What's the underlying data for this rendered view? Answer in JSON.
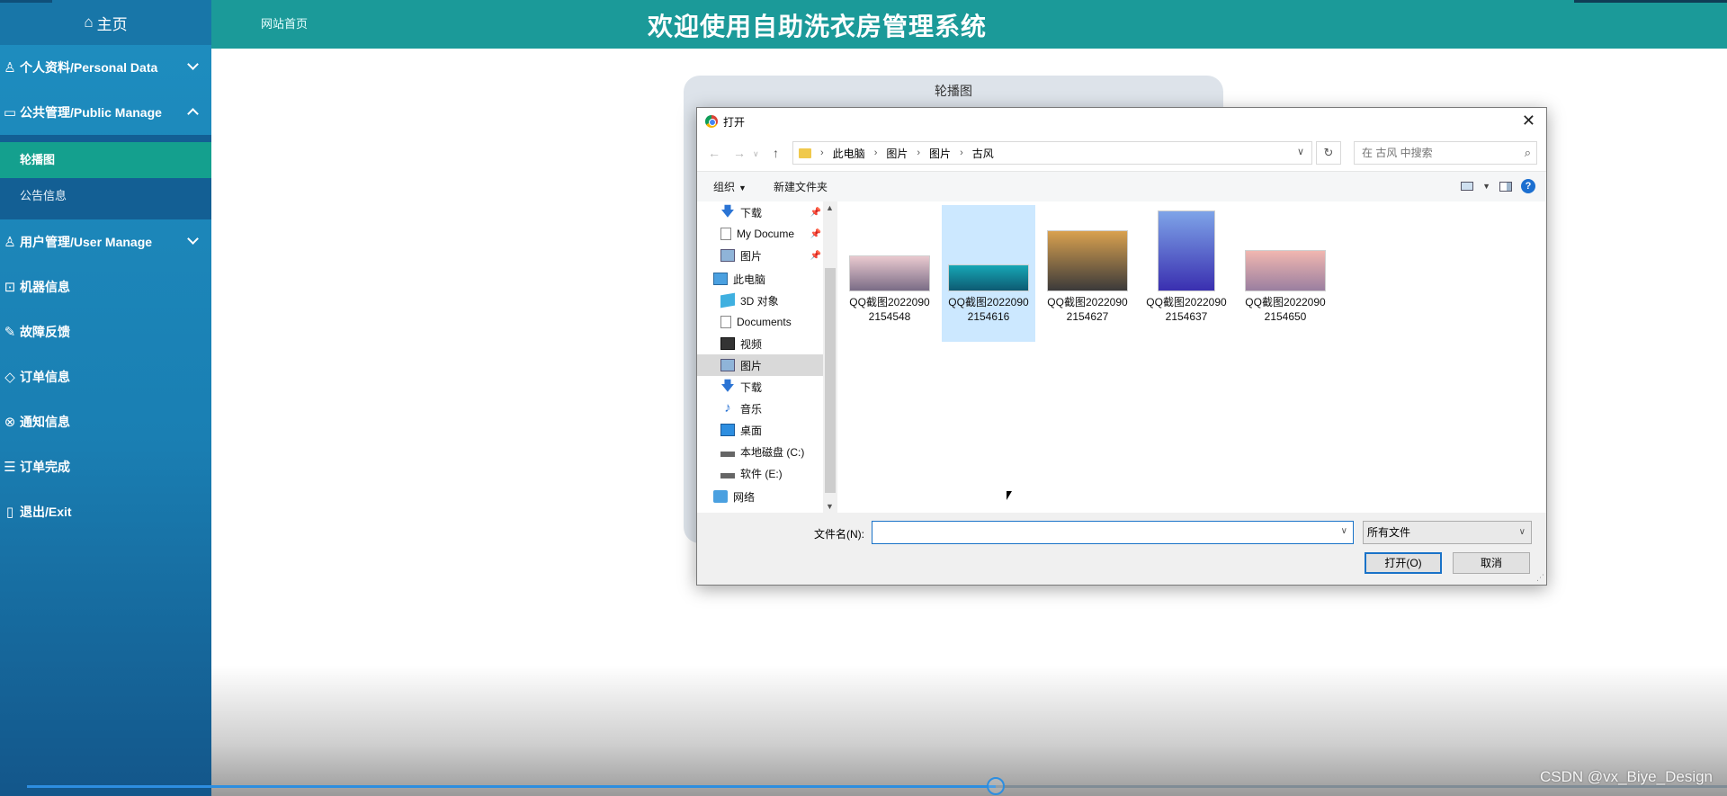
{
  "sidebar": {
    "home_label": "主页",
    "items": [
      {
        "label": "个人资料/Personal Data",
        "icon": "user-card-icon"
      },
      {
        "label": "公共管理/Public Manage",
        "icon": "monitor-icon"
      },
      {
        "label": "用户管理/User Manage",
        "icon": "user-icon"
      },
      {
        "label": "机器信息",
        "icon": "machine-icon"
      },
      {
        "label": "故障反馈",
        "icon": "wrench-icon"
      },
      {
        "label": "订单信息",
        "icon": "tag-icon"
      },
      {
        "label": "通知信息",
        "icon": "bell-icon"
      },
      {
        "label": "订单完成",
        "icon": "clipboard-icon"
      },
      {
        "label": "退出/Exit",
        "icon": "phone-icon"
      }
    ],
    "submenu": [
      {
        "label": "轮播图"
      },
      {
        "label": "公告信息"
      }
    ]
  },
  "topbar": {
    "nav_link": "网站首页",
    "title": "欢迎使用自助洗衣房管理系统"
  },
  "card": {
    "title": "轮播图"
  },
  "dialog": {
    "title": "打开",
    "breadcrumbs": [
      "此电脑",
      "图片",
      "图片",
      "古风"
    ],
    "search_placeholder": "在 古风 中搜索",
    "toolbar": {
      "organize": "组织",
      "new_folder": "新建文件夹"
    },
    "tree": [
      {
        "label": "下载",
        "icon": "down-arrow",
        "pinned": true,
        "indent": 1
      },
      {
        "label": "My Docume",
        "icon": "doc",
        "pinned": true,
        "indent": 1
      },
      {
        "label": "图片",
        "icon": "pic",
        "pinned": true,
        "indent": 1
      },
      {
        "label": "此电脑",
        "icon": "pc",
        "pinned": false,
        "indent": 0
      },
      {
        "label": "3D 对象",
        "icon": "3d",
        "pinned": false,
        "indent": 1
      },
      {
        "label": "Documents",
        "icon": "doc",
        "pinned": false,
        "indent": 1
      },
      {
        "label": "视频",
        "icon": "vid",
        "pinned": false,
        "indent": 1
      },
      {
        "label": "图片",
        "icon": "pic",
        "pinned": false,
        "indent": 1,
        "selected": true
      },
      {
        "label": "下载",
        "icon": "down-arrow",
        "pinned": false,
        "indent": 1
      },
      {
        "label": "音乐",
        "icon": "music",
        "pinned": false,
        "indent": 1
      },
      {
        "label": "桌面",
        "icon": "desk",
        "pinned": false,
        "indent": 1
      },
      {
        "label": "本地磁盘 (C:)",
        "icon": "disk",
        "pinned": false,
        "indent": 1
      },
      {
        "label": "软件 (E:)",
        "icon": "disk",
        "pinned": false,
        "indent": 1
      },
      {
        "label": "网络",
        "icon": "net",
        "pinned": false,
        "indent": 0
      }
    ],
    "files": [
      {
        "name": "QQ截图20220902154548",
        "selected": false,
        "colors": [
          "#e9c9cf",
          "#7a6c86"
        ]
      },
      {
        "name": "QQ截图20220902154616",
        "selected": true,
        "colors": [
          "#17a7b5",
          "#0d5a72"
        ]
      },
      {
        "name": "QQ截图20220902154627",
        "selected": false,
        "colors": [
          "#d9a14f",
          "#3b3a3a"
        ]
      },
      {
        "name": "QQ截图20220902154637",
        "selected": false,
        "colors": [
          "#7ea4e8",
          "#3a2fb0"
        ]
      },
      {
        "name": "QQ截图20220902154650",
        "selected": false,
        "colors": [
          "#f1b7b0",
          "#9a7fa0"
        ]
      }
    ],
    "filename_label": "文件名(N):",
    "filename_value": "",
    "filetype": "所有文件",
    "open_button": "打开(O)",
    "cancel_button": "取消"
  },
  "video": {
    "progress": 0.57,
    "watermark": "CSDN @vx_Biye_Design"
  },
  "colors": {
    "topbar": "#1b9a99",
    "sidebar": "#1a7fb3",
    "active_sub": "#14a08e",
    "dialog_accent": "#1a73c8"
  }
}
